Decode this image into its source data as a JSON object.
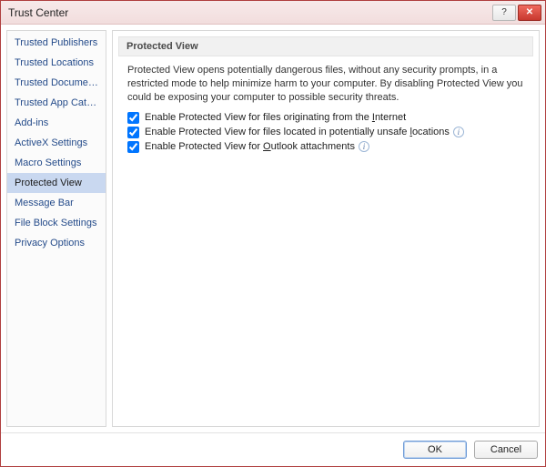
{
  "window": {
    "title": "Trust Center"
  },
  "sidebar": {
    "items": [
      {
        "label": "Trusted Publishers"
      },
      {
        "label": "Trusted Locations"
      },
      {
        "label": "Trusted Documents"
      },
      {
        "label": "Trusted App Catalogs"
      },
      {
        "label": "Add-ins"
      },
      {
        "label": "ActiveX Settings"
      },
      {
        "label": "Macro Settings"
      },
      {
        "label": "Protected View"
      },
      {
        "label": "Message Bar"
      },
      {
        "label": "File Block Settings"
      },
      {
        "label": "Privacy Options"
      }
    ],
    "selectedIndex": 7
  },
  "main": {
    "heading": "Protected View",
    "description": "Protected View opens potentially dangerous files, without any security prompts, in a restricted mode to help minimize harm to your computer. By disabling Protected View you could be exposing your computer to possible security threats.",
    "options": [
      {
        "label_pre": "Enable Protected View for files originating from the ",
        "underlined": "I",
        "label_post": "nternet",
        "checked": true,
        "info": false
      },
      {
        "label_pre": "Enable Protected View for files located in potentially unsafe ",
        "underlined": "l",
        "label_post": "ocations",
        "checked": true,
        "info": true
      },
      {
        "label_pre": "Enable Protected View for ",
        "underlined": "O",
        "label_post": "utlook attachments",
        "checked": true,
        "info": true
      }
    ]
  },
  "footer": {
    "ok": "OK",
    "cancel": "Cancel"
  }
}
